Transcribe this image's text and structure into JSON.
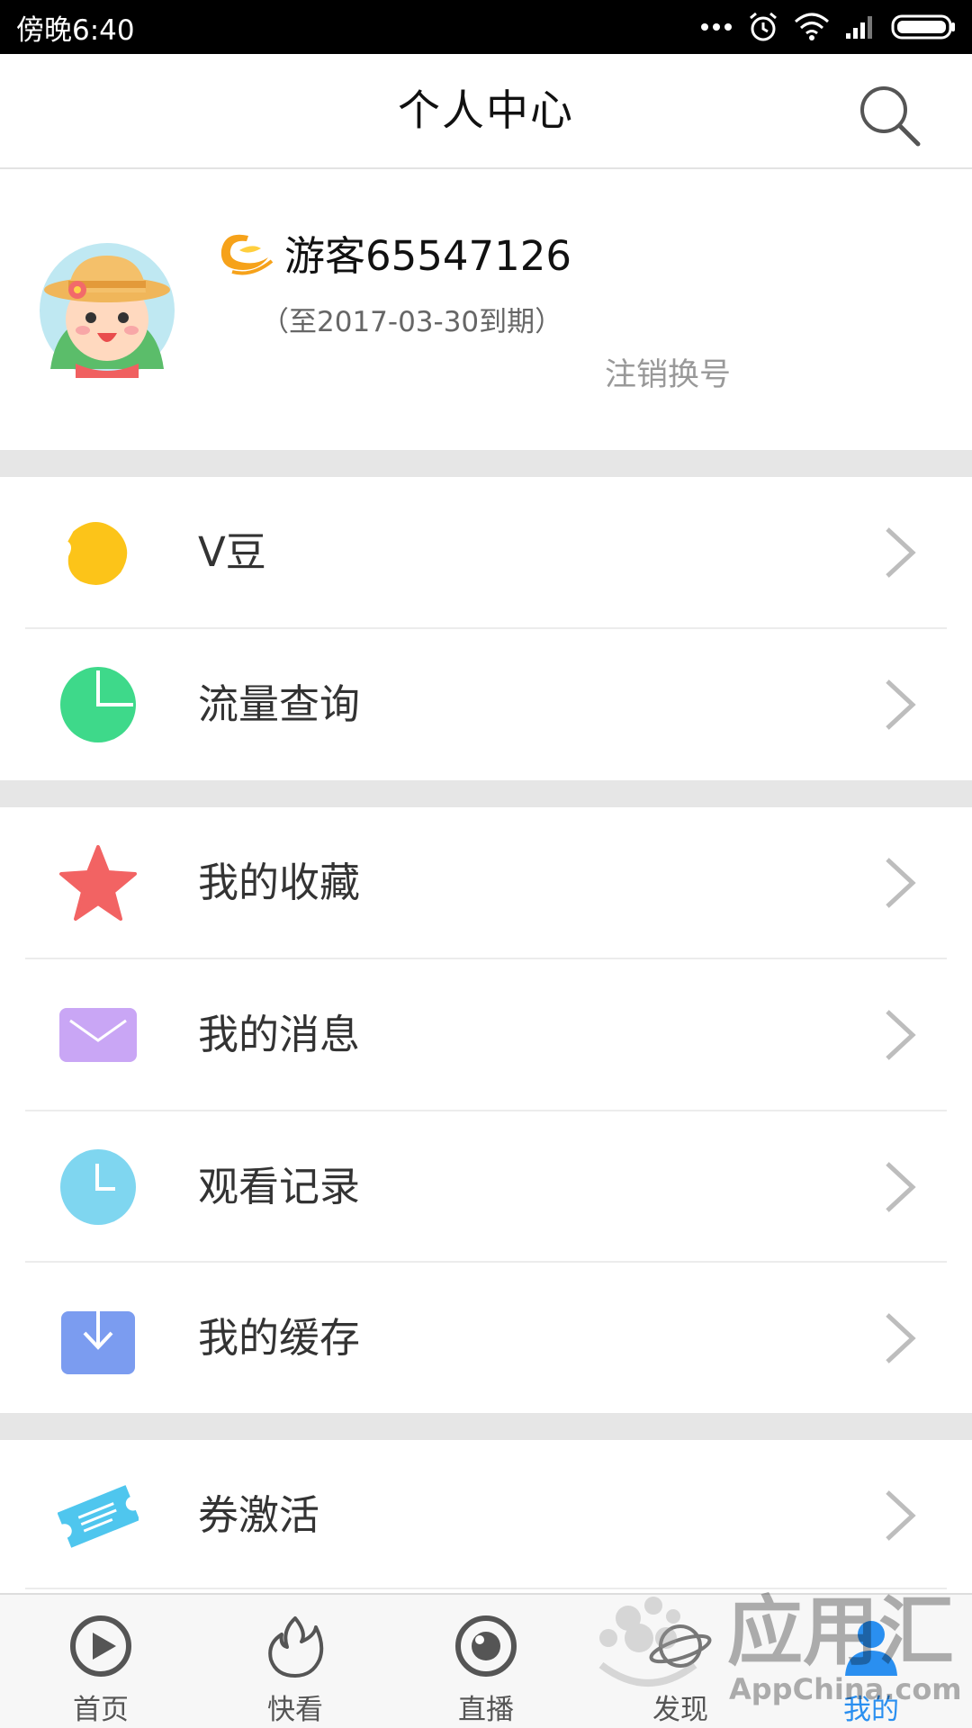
{
  "status_bar": {
    "time": "傍晚6:40"
  },
  "header": {
    "title": "个人中心"
  },
  "profile": {
    "username": "游客65547126",
    "expiry": "（至2017-03-30到期）",
    "logout_label": "注销换号"
  },
  "menu": {
    "items": [
      {
        "label": "V豆",
        "icon": "bean-icon"
      },
      {
        "label": "流量查询",
        "icon": "pie-chart-icon"
      },
      {
        "label": "我的收藏",
        "icon": "star-icon"
      },
      {
        "label": "我的消息",
        "icon": "envelope-icon"
      },
      {
        "label": "观看记录",
        "icon": "clock-icon"
      },
      {
        "label": "我的缓存",
        "icon": "download-icon"
      },
      {
        "label": "券激活",
        "icon": "ticket-icon"
      }
    ]
  },
  "bottom_nav": {
    "items": [
      {
        "label": "首页",
        "icon": "play-circle-icon",
        "active": false
      },
      {
        "label": "快看",
        "icon": "flame-icon",
        "active": false
      },
      {
        "label": "直播",
        "icon": "live-eye-icon",
        "active": false
      },
      {
        "label": "发现",
        "icon": "planet-icon",
        "active": false
      },
      {
        "label": "我的",
        "icon": "person-icon",
        "active": true
      }
    ]
  },
  "watermark": {
    "text_cn": "应用汇",
    "text_en": "AppChina.com"
  },
  "colors": {
    "active": "#2a8ff0",
    "bean": "#fcc419",
    "pie": "#3ed98a",
    "star": "#f26363",
    "envelope": "#c9a6f5",
    "clock": "#7fd6f0",
    "download": "#7b9cf0",
    "ticket": "#4fc6ee",
    "band": "#e6e6e6"
  }
}
